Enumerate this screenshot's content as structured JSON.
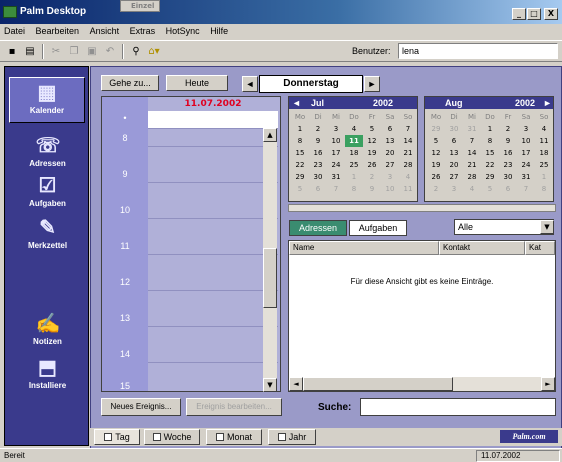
{
  "window": {
    "title": "Palm Desktop",
    "behind_tab": "Einzel",
    "min": "_",
    "max": "□",
    "close": "X"
  },
  "menu": [
    "Datei",
    "Bearbeiten",
    "Ansicht",
    "Extras",
    "HotSync",
    "Hilfe"
  ],
  "toolbar": {
    "user_label": "Benutzer:",
    "user_value": "lena"
  },
  "sidebar": [
    {
      "label": "Kalender",
      "icon": "calendar-icon"
    },
    {
      "label": "Adressen",
      "icon": "phone-icon"
    },
    {
      "label": "Aufgaben",
      "icon": "tasks-icon"
    },
    {
      "label": "Merkzettel",
      "icon": "memo-icon"
    },
    {
      "label": "Notizen",
      "icon": "notes-icon"
    },
    {
      "label": "Installiere",
      "icon": "install-icon"
    }
  ],
  "nav": {
    "goto": "Gehe zu...",
    "today": "Heute",
    "prev": "◄",
    "next": "►",
    "day": "Donnerstag"
  },
  "dayview": {
    "date": "11.07.2002",
    "hours": [
      "8",
      "9",
      "10",
      "11",
      "12",
      "13",
      "14",
      "15"
    ]
  },
  "calendars": [
    {
      "month": "Jul",
      "year": "2002",
      "dow": [
        "Mo",
        "Di",
        "Mi",
        "Do",
        "Fr",
        "Sa",
        "So"
      ],
      "days": [
        "1",
        "2",
        "3",
        "4",
        "5",
        "6",
        "7",
        "8",
        "9",
        "10",
        "11",
        "12",
        "13",
        "14",
        "15",
        "16",
        "17",
        "18",
        "19",
        "20",
        "21",
        "22",
        "23",
        "24",
        "25",
        "26",
        "27",
        "28",
        "29",
        "30",
        "31",
        "1",
        "2",
        "3",
        "4",
        "5",
        "6",
        "7",
        "8",
        "9",
        "10",
        "11"
      ]
    },
    {
      "month": "Aug",
      "year": "2002",
      "dow": [
        "Mo",
        "Di",
        "Mi",
        "Do",
        "Fr",
        "Sa",
        "So"
      ],
      "days": [
        "29",
        "30",
        "31",
        "1",
        "2",
        "3",
        "4",
        "5",
        "6",
        "7",
        "8",
        "9",
        "10",
        "11",
        "12",
        "13",
        "14",
        "15",
        "16",
        "17",
        "18",
        "19",
        "20",
        "21",
        "22",
        "23",
        "24",
        "25",
        "26",
        "27",
        "28",
        "29",
        "30",
        "31",
        "1",
        "2",
        "3",
        "4",
        "5",
        "6",
        "7",
        "8"
      ]
    }
  ],
  "tabs": {
    "addresses": "Adressen",
    "tasks": "Aufgaben",
    "filter": "Alle"
  },
  "list": {
    "col_name": "Name",
    "col_contact": "Kontakt",
    "col_cat": "Kat",
    "empty": "Für diese Ansicht gibt es keine Einträge."
  },
  "bottom": {
    "new_event": "Neues Ereignis...",
    "edit_event": "Ereignis bearbeiten...",
    "search_label": "Suche:"
  },
  "viewtabs": [
    "Tag",
    "Woche",
    "Monat",
    "Jahr"
  ],
  "brand": "Palm.com",
  "status": {
    "text": "Bereit",
    "date": "11.07.2002"
  }
}
